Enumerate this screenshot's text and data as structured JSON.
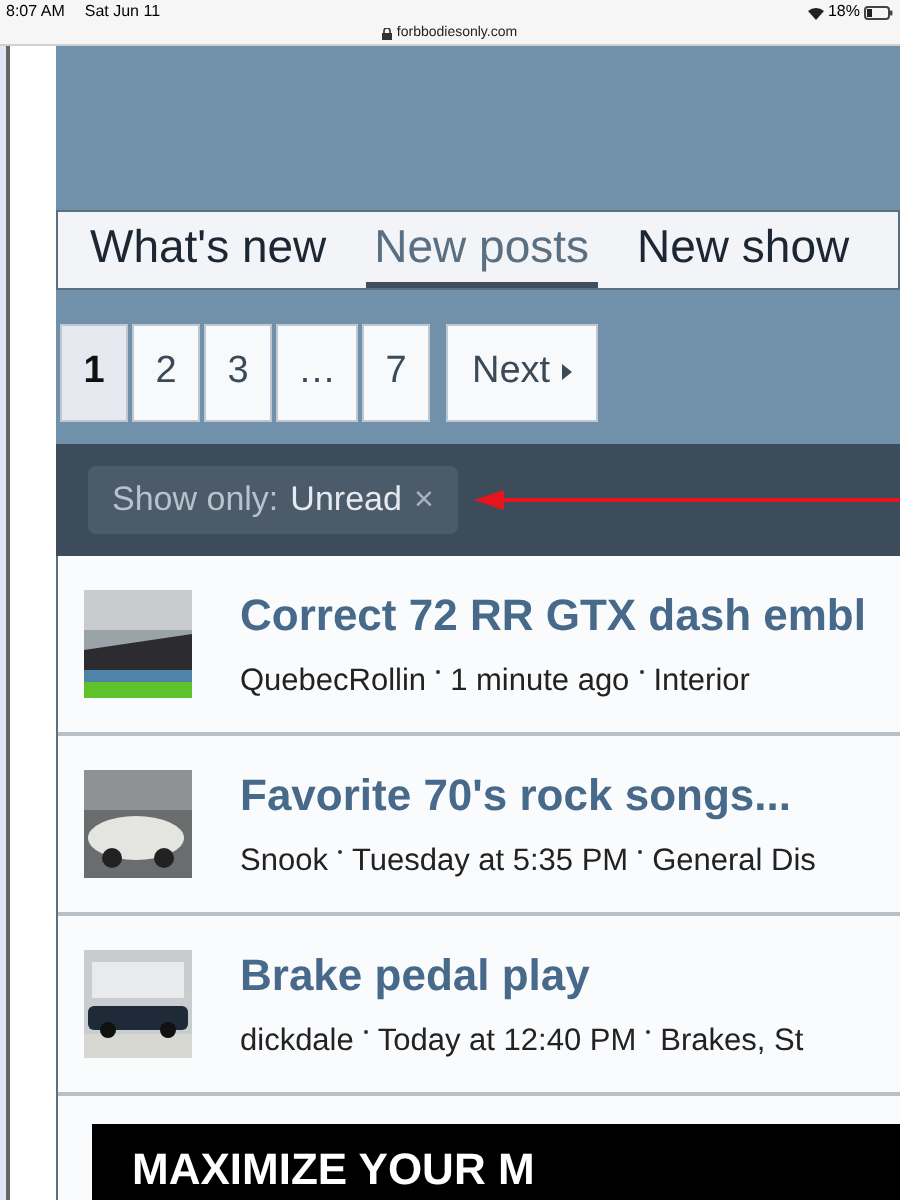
{
  "status_bar": {
    "time": "8:07 AM",
    "date": "Sat Jun 11",
    "battery": "18%"
  },
  "address_bar": {
    "url": "forbbodiesonly.com"
  },
  "tabs": [
    {
      "label": "What's new",
      "selected": false
    },
    {
      "label": "New posts",
      "selected": true
    },
    {
      "label": "New show",
      "selected": false
    }
  ],
  "pagination": {
    "pages": [
      {
        "label": "1",
        "selected": true
      },
      {
        "label": "2",
        "selected": false
      },
      {
        "label": "3",
        "selected": false
      },
      {
        "label": "…",
        "selected": false
      },
      {
        "label": "7",
        "selected": false
      }
    ],
    "next": "Next"
  },
  "filter": {
    "label": "Show only:",
    "value": "Unread",
    "remove": "×"
  },
  "threads": [
    {
      "title": "Correct 72 RR GTX dash embl",
      "author": "QuebecRollin",
      "time": "1 minute ago",
      "forum": "Interior"
    },
    {
      "title": "Favorite 70's rock songs...",
      "author": "Snook",
      "time": "Tuesday at 5:35 PM",
      "forum": "General Dis"
    },
    {
      "title": "Brake pedal play",
      "author": "dickdale",
      "time": "Today at 12:40 PM",
      "forum": "Brakes, St"
    }
  ],
  "ad": {
    "text": "MAXIMIZE YOUR M"
  }
}
